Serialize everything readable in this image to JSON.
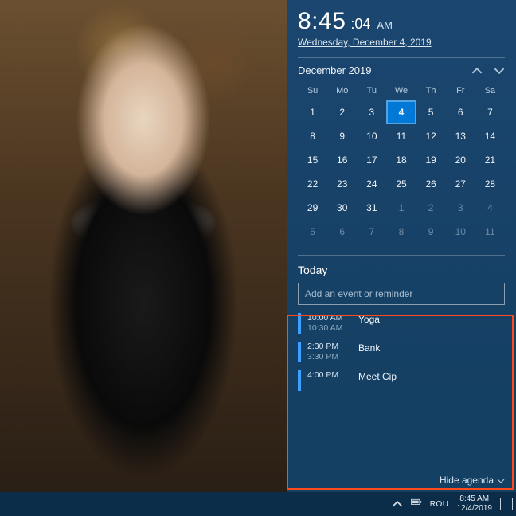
{
  "clock": {
    "hhmm": "8:45",
    "ss": ":04",
    "ampm": "AM",
    "date_long": "Wednesday, December 4, 2019"
  },
  "calendar": {
    "month_label": "December 2019",
    "day_headers": [
      "Su",
      "Mo",
      "Tu",
      "We",
      "Th",
      "Fr",
      "Sa"
    ],
    "weeks": [
      [
        {
          "d": "1"
        },
        {
          "d": "2"
        },
        {
          "d": "3"
        },
        {
          "d": "4",
          "today": true
        },
        {
          "d": "5"
        },
        {
          "d": "6"
        },
        {
          "d": "7"
        }
      ],
      [
        {
          "d": "8"
        },
        {
          "d": "9"
        },
        {
          "d": "10"
        },
        {
          "d": "11"
        },
        {
          "d": "12"
        },
        {
          "d": "13"
        },
        {
          "d": "14"
        }
      ],
      [
        {
          "d": "15"
        },
        {
          "d": "16"
        },
        {
          "d": "17"
        },
        {
          "d": "18"
        },
        {
          "d": "19"
        },
        {
          "d": "20"
        },
        {
          "d": "21"
        }
      ],
      [
        {
          "d": "22"
        },
        {
          "d": "23"
        },
        {
          "d": "24"
        },
        {
          "d": "25"
        },
        {
          "d": "26"
        },
        {
          "d": "27"
        },
        {
          "d": "28"
        }
      ],
      [
        {
          "d": "29"
        },
        {
          "d": "30"
        },
        {
          "d": "31"
        },
        {
          "d": "1",
          "dim": true
        },
        {
          "d": "2",
          "dim": true
        },
        {
          "d": "3",
          "dim": true
        },
        {
          "d": "4",
          "dim": true
        }
      ],
      [
        {
          "d": "5",
          "dim": true
        },
        {
          "d": "6",
          "dim": true
        },
        {
          "d": "7",
          "dim": true
        },
        {
          "d": "8",
          "dim": true
        },
        {
          "d": "9",
          "dim": true
        },
        {
          "d": "10",
          "dim": true
        },
        {
          "d": "11",
          "dim": true
        }
      ]
    ]
  },
  "agenda": {
    "heading": "Today",
    "placeholder": "Add an event or reminder",
    "hide_label": "Hide agenda",
    "events": [
      {
        "start": "10:00 AM",
        "end": "10:30 AM",
        "title": "Yoga"
      },
      {
        "start": "2:30 PM",
        "end": "3:30 PM",
        "title": "Bank"
      },
      {
        "start": "4:00 PM",
        "end": "",
        "title": "Meet Cip"
      }
    ]
  },
  "taskbar": {
    "lang": "ROU",
    "time": "8:45 AM",
    "date": "12/4/2019"
  }
}
